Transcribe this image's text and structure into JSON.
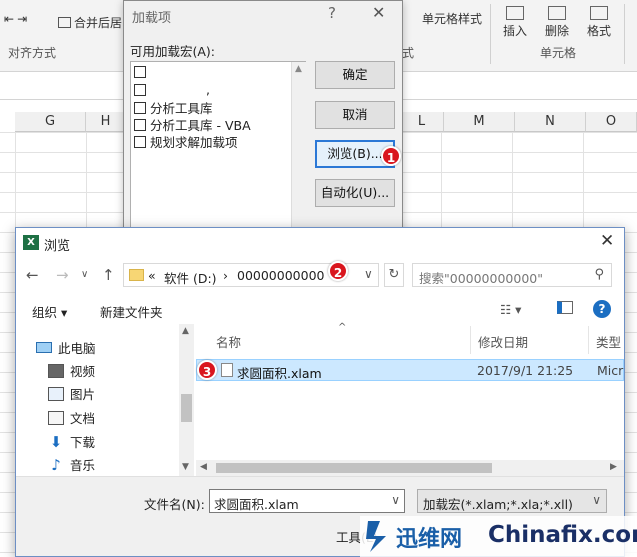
{
  "excel": {
    "ribbon": {
      "merge_center": "合并后居",
      "alignment_group": "对齐方式",
      "cell_styles": "单元格样式",
      "insert": "插入",
      "delete": "删除",
      "format": "格式",
      "cells_group": "单元格",
      "partial_group_char": "式"
    },
    "columns": [
      "G",
      "H",
      "L",
      "M",
      "N",
      "O"
    ]
  },
  "addins_dialog": {
    "title": "加载项",
    "help": "?",
    "close": "✕",
    "available_label": "可用加载宏(A):",
    "items": [
      {
        "label": "",
        "checked": false
      },
      {
        "label": ",",
        "checked": false
      },
      {
        "label": "分析工具库",
        "checked": false
      },
      {
        "label": "分析工具库 - VBA",
        "checked": false
      },
      {
        "label": "规划求解加载项",
        "checked": false
      }
    ],
    "buttons": {
      "ok": "确定",
      "cancel": "取消",
      "browse": "浏览(B)...",
      "automation": "自动化(U)..."
    }
  },
  "browse_dialog": {
    "app_icon": "X",
    "title": "浏览",
    "close": "✕",
    "path": {
      "prefix": "«",
      "drive": "软件 (D:)",
      "sep": "›",
      "folder": "00000000000"
    },
    "search_placeholder": "搜索\"00000000000\"",
    "toolbar": {
      "organize": "组织 ▾",
      "new_folder": "新建文件夹",
      "help": "?"
    },
    "nav": [
      {
        "label": "此电脑",
        "icon": "computer-icon"
      },
      {
        "label": "视频",
        "icon": "video-icon"
      },
      {
        "label": "图片",
        "icon": "picture-icon"
      },
      {
        "label": "文档",
        "icon": "document-icon"
      },
      {
        "label": "下载",
        "icon": "download-icon"
      },
      {
        "label": "音乐",
        "icon": "music-icon"
      }
    ],
    "columns": {
      "name": "名称",
      "date": "修改日期",
      "type": "类型"
    },
    "files": [
      {
        "name": "求圆面积.xlam",
        "date": "2017/9/1 21:25",
        "type": "Micr"
      }
    ],
    "filename_label": "文件名(N):",
    "filename_value": "求圆面积.xlam",
    "filetype_value": "加载宏(*.xlam;*.xla;*.xll)",
    "tools": "工具(L)"
  },
  "badges": [
    "1",
    "2",
    "3"
  ],
  "watermark": {
    "cn": "迅维网",
    "en": "Chinafix.com"
  }
}
